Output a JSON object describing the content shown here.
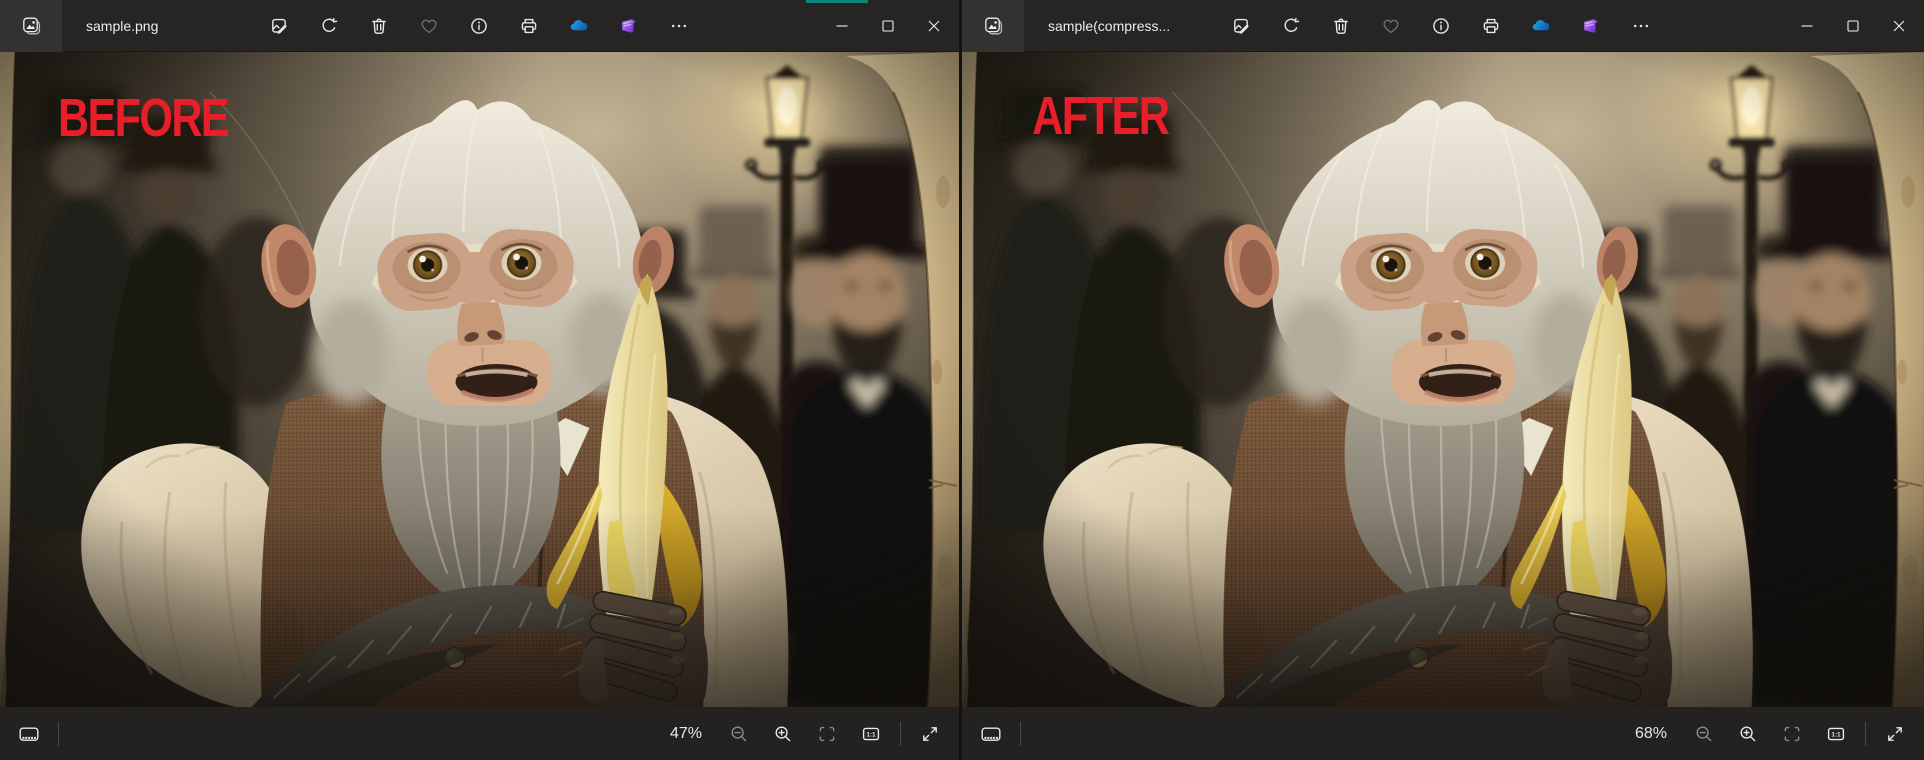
{
  "colors": {
    "snap_indicator": "#108579",
    "overlay_label_red": "#e81f2b",
    "onedrive_blue": "#1492df",
    "clipchamp_purple": "#8b5cf6"
  },
  "statusbar_shared": {
    "actual_size_label": "1:1"
  },
  "windows": [
    {
      "title": "sample.png",
      "overlay_label": "BEFORE",
      "zoom_percent": "47%",
      "toolbar_icons": [
        "edit-image",
        "rotate",
        "delete",
        "favorite",
        "info",
        "print",
        "onedrive",
        "clipchamp",
        "more"
      ],
      "window_controls": [
        "minimize",
        "maximize",
        "close"
      ],
      "statusbar_icons": [
        "filmstrip",
        "zoom-out",
        "zoom-in",
        "fit-to-window",
        "actual-size",
        "fullscreen"
      ]
    },
    {
      "title": "sample(compress...",
      "overlay_label": "AFTER",
      "zoom_percent": "68%",
      "toolbar_icons": [
        "edit-image",
        "rotate",
        "delete",
        "favorite",
        "info",
        "print",
        "onedrive",
        "clipchamp",
        "more"
      ],
      "window_controls": [
        "minimize",
        "maximize",
        "close"
      ],
      "statusbar_icons": [
        "filmstrip",
        "zoom-out",
        "zoom-in",
        "fit-to-window",
        "actual-size",
        "fullscreen"
      ]
    }
  ]
}
